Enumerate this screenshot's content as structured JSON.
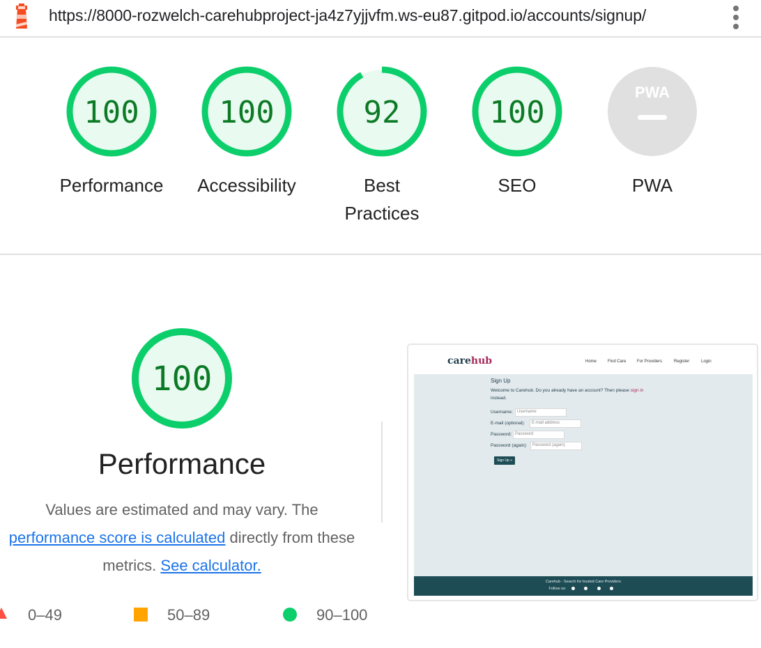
{
  "browser": {
    "url": "https://8000-rozwelch-carehubproject-ja4z7yjjvfm.ws-eu87.gitpod.io/accounts/signup/",
    "logo_icon": "lighthouse-icon",
    "menu_icon": "more-vert-icon"
  },
  "colors": {
    "pass": "#0cce6b",
    "pass_text": "#0c7a26",
    "pass_fill": "#e9faf0",
    "average": "#ffa400",
    "fail": "#ff4e42",
    "na": "#e0e0e0"
  },
  "categories": [
    {
      "label": "Performance",
      "score": "100",
      "score_value": 100,
      "status": "pass"
    },
    {
      "label": "Accessibility",
      "score": "100",
      "score_value": 100,
      "status": "pass"
    },
    {
      "label": "Best Practices",
      "score": "92",
      "score_value": 92,
      "status": "pass"
    },
    {
      "label": "SEO",
      "score": "100",
      "score_value": 100,
      "status": "pass"
    },
    {
      "label": "PWA",
      "badge": "PWA",
      "score": "—",
      "status": "na"
    }
  ],
  "performance": {
    "score": "100",
    "score_value": 100,
    "title": "Performance",
    "desc_before": "Values are estimated and may vary. The ",
    "link_score": "performance score is calculated",
    "desc_middle": " directly from these metrics. ",
    "link_calc": "See calculator."
  },
  "legend": [
    {
      "range": "0–49",
      "shape": "triangle",
      "color": "#ff4e42"
    },
    {
      "range": "50–89",
      "shape": "square",
      "color": "#ffa400"
    },
    {
      "range": "90–100",
      "shape": "circle",
      "color": "#0cce6b"
    }
  ],
  "screenshot": {
    "logo_care": "care",
    "logo_hub": "hub",
    "nav": [
      "Home",
      "Find Care",
      "For Providers",
      "Register",
      "Login"
    ],
    "heading": "Sign Up",
    "intro_before": "Welcome to Carehub. Do you already have an account? Then please ",
    "intro_link": "sign in",
    "intro_after": "instead.",
    "fields": [
      {
        "label": "Username:",
        "placeholder": "Username"
      },
      {
        "label": "E-mail (optional):",
        "placeholder": "E-mail address"
      },
      {
        "label": "Password:",
        "placeholder": "Password"
      },
      {
        "label": "Password (again):",
        "placeholder": "Password (again)"
      }
    ],
    "button": "Sign Up »",
    "footer_line1": "Carehub - Search for trusted Care Providers",
    "footer_follow": "Follow us:"
  }
}
